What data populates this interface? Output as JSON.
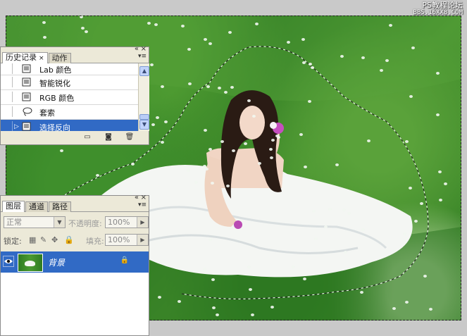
{
  "watermark": {
    "line1": "PS教程论坛",
    "line2": "BBS.16XX8.COM"
  },
  "history_panel": {
    "tabs": [
      {
        "label": "历史记录",
        "close": "×",
        "active": true
      },
      {
        "label": "动作",
        "active": false
      }
    ],
    "window_controls": {
      "minimize": "«",
      "close": "×"
    },
    "menu_icon": "panel-menu-icon",
    "items": [
      {
        "label": "Lab 颜色",
        "icon": "document-icon",
        "selected": false
      },
      {
        "label": "智能锐化",
        "icon": "document-icon",
        "selected": false
      },
      {
        "label": "RGB 颜色",
        "icon": "document-icon",
        "selected": false
      },
      {
        "label": "套索",
        "icon": "lasso-icon",
        "selected": false
      },
      {
        "label": "选择反向",
        "icon": "document-icon",
        "selected": true
      }
    ],
    "current_marker": "▷",
    "footer_buttons": [
      "new-document-from-state-icon",
      "snapshot-camera-icon",
      "delete-trash-icon"
    ]
  },
  "layers_panel": {
    "tabs": [
      {
        "label": "图层",
        "active": true
      },
      {
        "label": "通道",
        "active": false
      },
      {
        "label": "路径",
        "active": false
      }
    ],
    "blend_mode": "正常",
    "opacity_label": "不透明度:",
    "opacity_value": "100%",
    "lock_label": "锁定:",
    "fill_label": "填充:",
    "fill_value": "100%",
    "layers": [
      {
        "name": "背景",
        "visible": true,
        "locked": true,
        "selected": true
      }
    ]
  }
}
